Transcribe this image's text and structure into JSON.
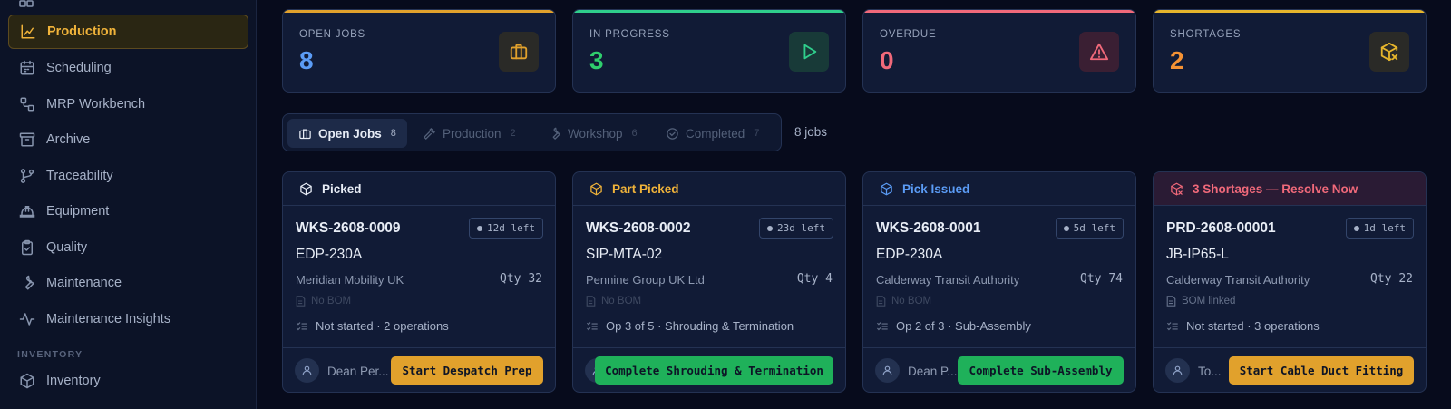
{
  "sidebar": {
    "items": [
      {
        "label": "Production",
        "icon": "chart-icon"
      },
      {
        "label": "Scheduling",
        "icon": "calendar-icon"
      },
      {
        "label": "MRP Workbench",
        "icon": "workflow-icon"
      },
      {
        "label": "Archive",
        "icon": "archive-icon"
      },
      {
        "label": "Traceability",
        "icon": "git-branch-icon"
      },
      {
        "label": "Equipment",
        "icon": "hardhat-icon"
      },
      {
        "label": "Quality",
        "icon": "clipboard-check-icon"
      },
      {
        "label": "Maintenance",
        "icon": "wrench-icon"
      },
      {
        "label": "Maintenance Insights",
        "icon": "activity-icon"
      },
      {
        "label": "Inventory",
        "icon": "package-icon"
      }
    ],
    "section_inventory": "INVENTORY"
  },
  "stats": [
    {
      "label": "OPEN JOBS",
      "value": "8",
      "color": "#5b9cf6",
      "bar": "#e1a12c",
      "icon": "briefcase-icon"
    },
    {
      "label": "IN PROGRESS",
      "value": "3",
      "color": "#2fce6d",
      "bar": "#2fce8c",
      "icon": "play-icon"
    },
    {
      "label": "OVERDUE",
      "value": "0",
      "color": "#f0697a",
      "bar": "#f0697a",
      "icon": "alert-triangle-icon"
    },
    {
      "label": "SHORTAGES",
      "value": "2",
      "color": "#f59234",
      "bar": "#e6b52c",
      "icon": "package-x-icon"
    }
  ],
  "tabs": [
    {
      "label": "Open Jobs",
      "count": "8"
    },
    {
      "label": "Production",
      "count": "2"
    },
    {
      "label": "Workshop",
      "count": "6"
    },
    {
      "label": "Completed",
      "count": "7"
    }
  ],
  "job_count": "8 jobs",
  "cards": [
    {
      "status": "Picked",
      "status_color": "#e8edf6",
      "job_id": "WKS-2608-0009",
      "time_left": "12d left",
      "part": "EDP-230A",
      "customer": "Meridian Mobility UK",
      "qty": "Qty 32",
      "bom": "No BOM",
      "ops": "Not started · 2 operations",
      "assignee": "Dean Per...",
      "action": "Start Despatch Prep",
      "action_color": "amber"
    },
    {
      "status": "Part Picked",
      "status_color": "#f0b33a",
      "job_id": "WKS-2608-0002",
      "time_left": "23d left",
      "part": "SIP-MTA-02",
      "customer": "Pennine Group UK Ltd",
      "qty": "Qty 4",
      "bom": "No BOM",
      "ops": "Op 3 of 5 · Shrouding & Termination",
      "assignee": "",
      "action": "Complete Shrouding & Termination",
      "action_color": "green"
    },
    {
      "status": "Pick Issued",
      "status_color": "#5b9cf6",
      "job_id": "WKS-2608-0001",
      "time_left": "5d left",
      "part": "EDP-230A",
      "customer": "Calderway Transit Authority",
      "qty": "Qty 74",
      "bom": "No BOM",
      "ops": "Op 2 of 3 · Sub-Assembly",
      "assignee": "Dean P...",
      "action": "Complete Sub-Assembly",
      "action_color": "green"
    },
    {
      "status": "3 Shortages — Resolve Now",
      "status_color": "#f0697a",
      "job_id": "PRD-2608-00001",
      "time_left": "1d left",
      "part": "JB-IP65-L",
      "customer": "Calderway Transit Authority",
      "qty": "Qty 22",
      "bom": "BOM linked",
      "ops": "Not started · 3 operations",
      "assignee": "To...",
      "action": "Start Cable Duct Fitting",
      "action_color": "amber"
    }
  ]
}
